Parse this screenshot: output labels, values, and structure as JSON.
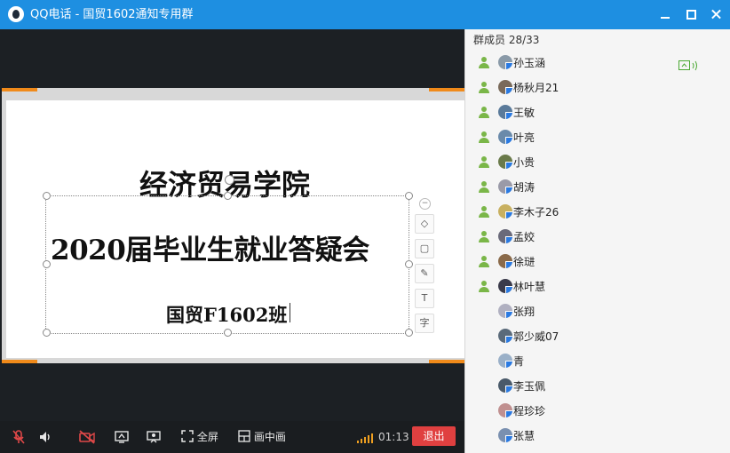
{
  "window": {
    "title": "QQ电话 - 国贸1602通知专用群"
  },
  "slide": {
    "title": "经济贸易学院",
    "subtitle": "2020届毕业生就业答疑会",
    "class_label": "国贸F1602班"
  },
  "toolbar": {
    "fullscreen_label": "全屏",
    "pip_label": "画中画",
    "timer": "01:13",
    "exit_label": "退出"
  },
  "members": {
    "header": "群成员 28/33",
    "list": [
      {
        "name": "孙玉涵",
        "online": true
      },
      {
        "name": "杨秋月21",
        "online": true
      },
      {
        "name": "王敏",
        "online": true
      },
      {
        "name": "叶亮",
        "online": true
      },
      {
        "name": "小贵",
        "online": true
      },
      {
        "name": "胡涛",
        "online": true
      },
      {
        "name": "李木子26",
        "online": true
      },
      {
        "name": "孟姣",
        "online": true
      },
      {
        "name": "徐琎",
        "online": true
      },
      {
        "name": "林叶慧",
        "online": true
      },
      {
        "name": "张翔",
        "online": false
      },
      {
        "name": "郭少威07",
        "online": false
      },
      {
        "name": "青",
        "online": false
      },
      {
        "name": "李玉佩",
        "online": false
      },
      {
        "name": "程珍珍",
        "online": false
      },
      {
        "name": "张慧",
        "online": false
      }
    ]
  },
  "colors": {
    "titlebar": "#1e8fe1",
    "exit": "#e04040",
    "online_green": "#7ab648",
    "accent_orange": "#f08a1a"
  }
}
